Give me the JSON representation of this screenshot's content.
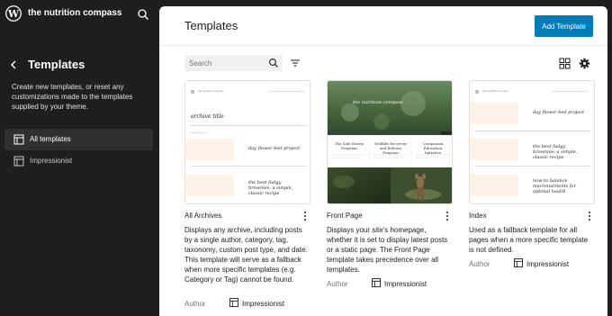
{
  "site": {
    "title": "the nutrition compass"
  },
  "sidebar": {
    "title": "Templates",
    "description": "Create new templates, or reset any customizations made to the templates supplied by your theme.",
    "items": [
      {
        "label": "All templates",
        "icon": "layout-icon",
        "active": true
      },
      {
        "label": "Impressionist",
        "icon": "layout-icon",
        "active": false
      }
    ]
  },
  "main": {
    "title": "Templates",
    "add_button": "Add Template",
    "search_placeholder": "Search"
  },
  "cards": [
    {
      "title": "All Archives",
      "description": "Displays any archive, including posts by a single author, category, tag, taxonomy, custom post type, and date. This template will serve as a fallback when more specific templates (e.g. Category or Tag) cannot be found.",
      "author_label": "Author",
      "author_name": "Impressionist",
      "preview": {
        "site_name": "the nutrition compass",
        "heading": "archive title",
        "post1": "day flower bed project",
        "post2": "the best fudgy brownies: a simple, classic recipe"
      }
    },
    {
      "title": "Front Page",
      "description": "Displays your site's homepage, whether it is set to display latest posts or a static page. The Front Page template takes precedence over all templates.",
      "author_label": "Author",
      "author_name": "Impressionist",
      "preview": {
        "banner": "the nutrition compass",
        "col1": "The Safe Haven Program",
        "col2": "Wildlife Recovery and Release Program",
        "col3": "Companion Education Initiative"
      }
    },
    {
      "title": "Index",
      "description": "Used as a fallback template for all pages when a more specific template is not defined.",
      "author_label": "Author",
      "author_name": "Impressionist",
      "preview": {
        "site_name": "the nutrition compass",
        "post1": "day flower bed project",
        "post2": "the best fudgy brownies: a simple, classic recipe",
        "post3": "how to balance macronutrients for optimal health"
      }
    }
  ],
  "colors": {
    "accent": "#007cba",
    "sidebar_bg": "#1e1e1e",
    "preview_block": "#fdf3e7"
  }
}
